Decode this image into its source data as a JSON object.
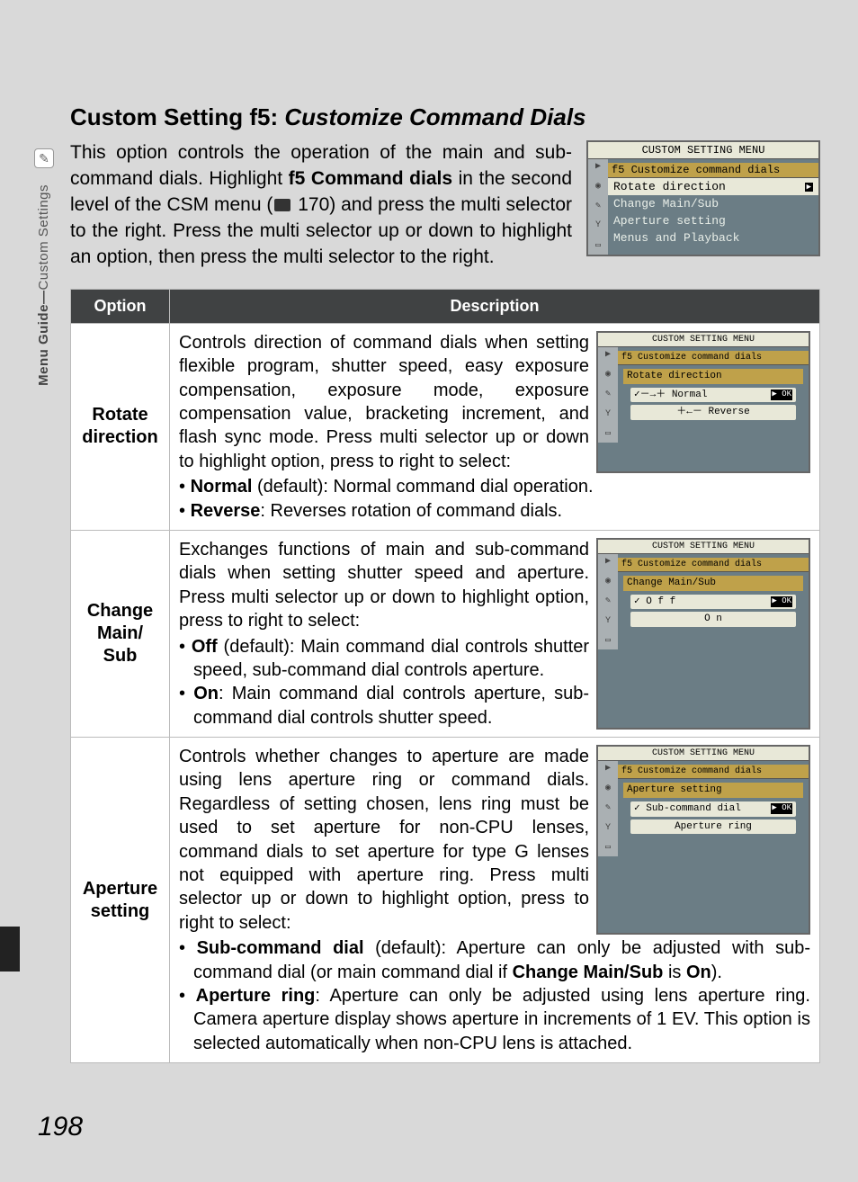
{
  "sidebar": {
    "label_bold": "Menu Guide—",
    "label_rest": "Custom Settings"
  },
  "heading_plain": "Custom Setting f5: ",
  "heading_italic": "Customize Command Dials",
  "intro": {
    "p1a": "This option controls the operation of the main and sub-command dials.  Highlight ",
    "p1b": "f5 Command dials",
    "p1c": " in the second level of the CSM menu (",
    "p1d": " 170) and press the multi selector to the right. Press the multi selector up or down to highlight an option, then press the multi selector to the right."
  },
  "lcd_main": {
    "title": "CUSTOM SETTING MENU",
    "sub": "f5  Customize command dials",
    "rows": [
      "Rotate direction",
      "Change Main/Sub",
      "Aperture setting",
      "Menus and Playback"
    ]
  },
  "table": {
    "head_option": "Option",
    "head_desc": "Description",
    "rows": [
      {
        "label": "Rotate direction",
        "body": "Controls direction of command dials when setting ﬂexible program, shutter speed, easy exposure compensation, exposure mode, exposure compensation value, bracketing increment, and ﬂash sync mode.  Press multi selector up or down to highlight option, press to right to select:",
        "bullets": [
          {
            "b": "Normal",
            "rest": " (default): Normal command dial operation."
          },
          {
            "b": "Reverse",
            "rest": ": Reverses rotation of command dials."
          }
        ],
        "lcd": {
          "title": "CUSTOM SETTING MENU",
          "sub": "f5  Customize command dials",
          "sub2": "Rotate direction",
          "optA_pre": "✓－→＋ ",
          "optA": "Normal",
          "optB_pre": "＋←－ ",
          "optB": "Reverse",
          "ok": "▶ OK"
        }
      },
      {
        "label": "Change Main/ Sub",
        "body": "Exchanges functions of main and sub-command dials when setting shutter speed and aperture. Press multi selector up or down to highlight option, press to right to select:",
        "bullets": [
          {
            "b": "Off",
            "rest": " (default): Main command dial controls shutter speed, sub-command dial controls aperture."
          },
          {
            "b": "On",
            "rest": ": Main command dial controls aperture, sub-command dial controls shutter speed."
          }
        ],
        "lcd": {
          "title": "CUSTOM SETTING MENU",
          "sub": "f5  Customize command dials",
          "sub2": "Change Main/Sub",
          "optA_pre": "✓   ",
          "optA": "O f f",
          "optB_pre": "    ",
          "optB": "O n",
          "ok": "▶ OK"
        }
      },
      {
        "label": "Aperture setting",
        "body": "Controls whether changes to aperture are made using lens aperture ring or command dials.  Regardless of setting chosen, lens ring must be used to set aperture for non-CPU lenses, command dials to set aperture for type G lenses not equipped with aperture ring.  Press multi selector up or down to highlight option, press to right to select:",
        "bullets": [
          {
            "b": "Sub-command dial",
            "rest": " (default): Aperture can only be adjusted with sub-command dial (or main command dial if ",
            "b2": "Change Main/Sub",
            "rest2": " is ",
            "b3": "On",
            "rest3": ")."
          },
          {
            "b": "Aperture ring",
            "rest": ": Aperture can only be adjusted using lens aperture ring. Camera aperture display shows aperture in increments of 1 EV.  This option is selected automatically when non-CPU lens is attached."
          }
        ],
        "lcd": {
          "title": "CUSTOM SETTING MENU",
          "sub": "f5  Customize command dials",
          "sub2": "Aperture setting",
          "optA_pre": "✓ ",
          "optA": "Sub-command dial",
          "optB_pre": "  ",
          "optB": "Aperture ring",
          "ok": "▶ OK"
        }
      }
    ]
  },
  "page_number": "198"
}
